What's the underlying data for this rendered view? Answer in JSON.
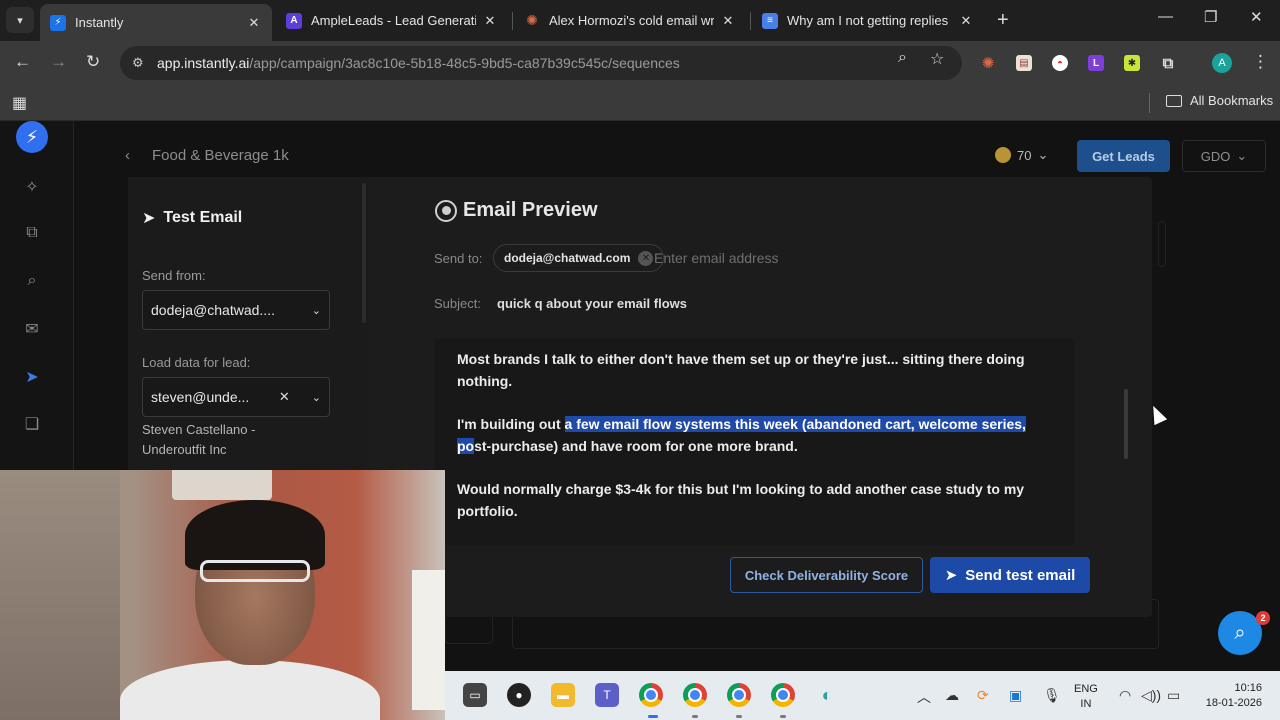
{
  "browser": {
    "tabs": [
      {
        "title": "Instantly",
        "favicon_color": "#1a73e8",
        "active": true
      },
      {
        "title": "AmpleLeads - Lead Generation",
        "favicon_color": "#5b3fd6",
        "active": false
      },
      {
        "title": "Alex Hormozi's cold email writi",
        "favicon_color": "#d96b4a",
        "active": false
      },
      {
        "title": "Why am I not getting replies - C",
        "favicon_color": "#4a7fe5",
        "active": false
      }
    ],
    "url_host": "app.instantly.ai",
    "url_path": "/app/campaign/3ac8c10e-5b18-48c5-9bd5-ca87b39c545c/sequences",
    "bookmarks_label": "All Bookmarks",
    "profile_initial": "A"
  },
  "app": {
    "campaign_name": "Food & Beverage 1k",
    "credits": "70",
    "get_leads_label": "Get Leads",
    "workspace_label": "GDO"
  },
  "test_email": {
    "title": "Test Email",
    "send_from_label": "Send from:",
    "send_from_value": "dodeja@chatwad....",
    "load_data_label": "Load data for lead:",
    "lead_value": "steven@unde...",
    "lead_name_line1": "Steven Castellano -",
    "lead_name_line2": "Underoutfit Inc"
  },
  "preview": {
    "title": "Email Preview",
    "send_to_label": "Send to:",
    "recipient": "dodeja@chatwad.com",
    "email_placeholder": "Enter email address",
    "subject_label": "Subject:",
    "subject": "quick q about your email flows",
    "para1": "Most brands I talk to either don't have them set up or they're just... sitting there doing nothing.",
    "para2_before": "I'm building out ",
    "para2_highlight": "a few email flow systems this week (abandoned cart, welcome series, po",
    "para2_after": "st-purchase) and have room for one more brand.",
    "para3": "Would normally charge $3-4k for this but I'm looking to add another case study to my portfolio.",
    "check_button": "Check Deliverability Score",
    "send_button": "Send test email"
  },
  "chat": {
    "badge": "2"
  },
  "taskbar": {
    "lang_line1": "ENG",
    "lang_line2": "IN",
    "time": "10:16",
    "date": "18-01-2026"
  }
}
